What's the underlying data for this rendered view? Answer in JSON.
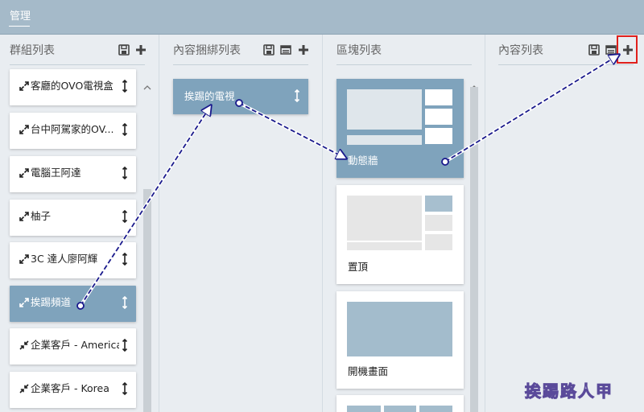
{
  "topbar": {
    "tab_label": "管理"
  },
  "columns": {
    "groups": {
      "title": "群組列表"
    },
    "bindings": {
      "title": "內容捆綁列表"
    },
    "blocks": {
      "title": "區塊列表"
    },
    "content": {
      "title": "內容列表"
    }
  },
  "groups": [
    {
      "label": "客廳的OVO電視盒",
      "selected": false,
      "icon": "expand-icon"
    },
    {
      "label": "台中阿駕家的OV...",
      "selected": false,
      "icon": "expand-icon"
    },
    {
      "label": "電腦王阿達",
      "selected": false,
      "icon": "expand-icon"
    },
    {
      "label": "柚子",
      "selected": false,
      "icon": "expand-icon"
    },
    {
      "label": "3C 達人廖阿輝",
      "selected": false,
      "icon": "expand-icon"
    },
    {
      "label": "挨踢頻道",
      "selected": true,
      "icon": "expand-icon"
    },
    {
      "label": "企業客戶 - America",
      "selected": false,
      "icon": "compress-icon"
    },
    {
      "label": "企業客戶 - Korea",
      "selected": false,
      "icon": "compress-icon"
    }
  ],
  "bindings": [
    {
      "label": "挨踢的電視",
      "selected": true
    }
  ],
  "blocks": [
    {
      "label": "動態牆",
      "selected": true
    },
    {
      "label": "置頂",
      "selected": false
    },
    {
      "label": "開機畫面",
      "selected": false
    }
  ],
  "watermark": "挨踢路人甲",
  "colors": {
    "accent": "#7fa3bc",
    "topbar": "#a5bac9",
    "highlight": "#e0201c",
    "arrow": "#1a1a8c"
  }
}
